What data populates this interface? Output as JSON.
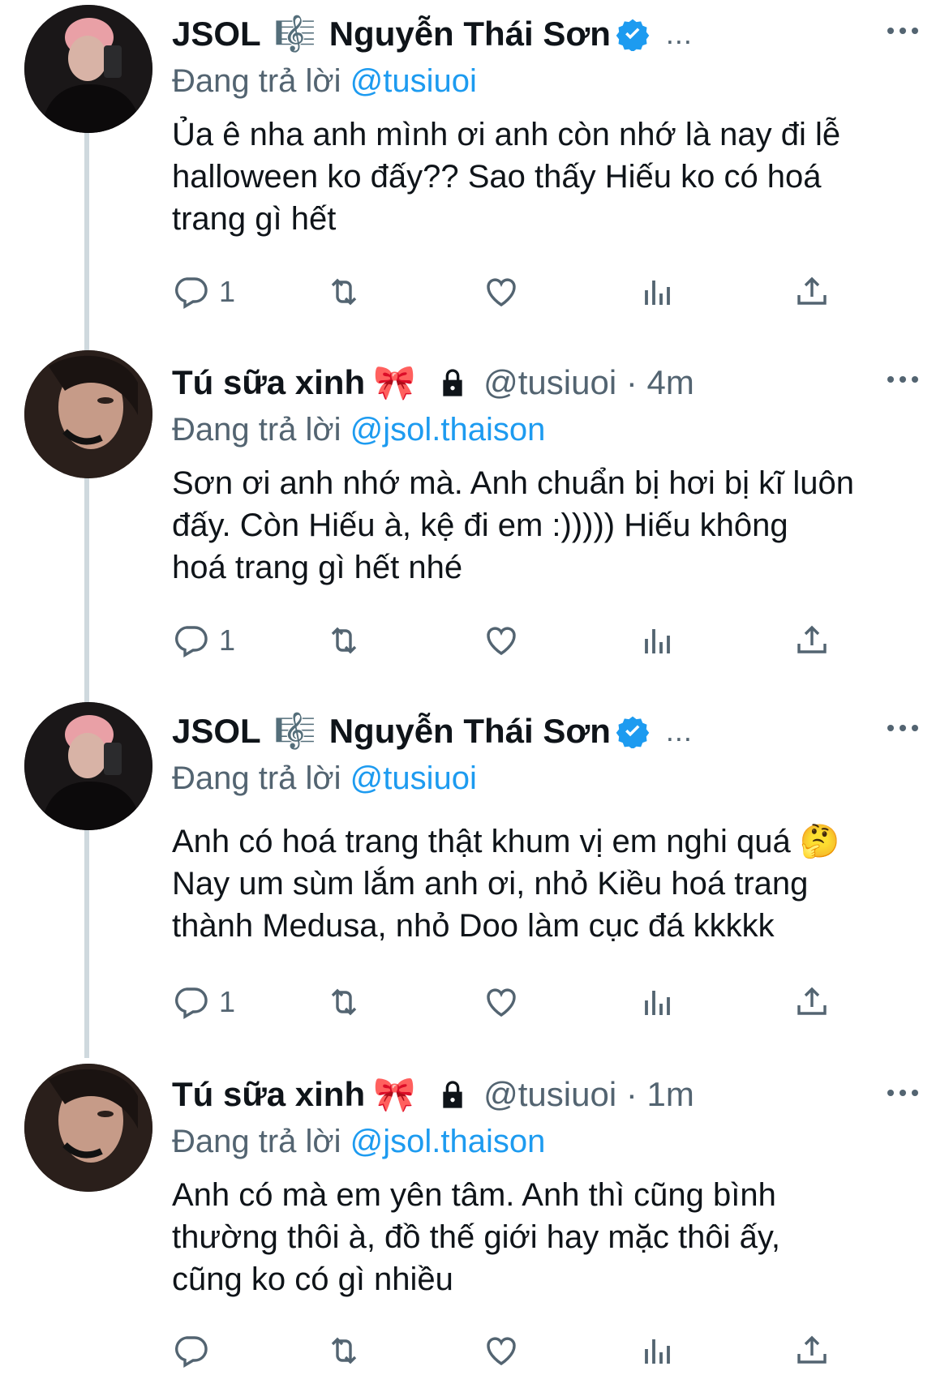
{
  "colors": {
    "accent": "#1d9bf0",
    "secondary_text": "#536471",
    "primary_text": "#0f1419",
    "thread_line": "#cfd9de"
  },
  "tweets": [
    {
      "author_display": "JSOL",
      "author_emoji": "🎼",
      "author_name": "Nguyễn Thái Sơn",
      "verified": true,
      "trailing_ellipsis": "...",
      "handle": "",
      "replying_prefix": "Đang trả lời",
      "replying_to": "@tusiuoi",
      "text": "Ủa ê nha anh mình ơi anh còn nhớ là nay đi lễ\nhalloween ko đấy?? Sao thấy Hiếu ko có hoá\ntrang gì hết",
      "reply_count": "1",
      "avatar_icon": "person-avatar-pink-hair"
    },
    {
      "author_display": "Tú sữa xinh",
      "author_emoji": "🎀",
      "lock_icon": "lock-icon",
      "handle": "@tusiuoi · 4m",
      "replying_prefix": "Đang trả lời",
      "replying_to": "@jsol.thaison",
      "text": "Sơn ơi anh nhớ mà. Anh chuẩn bị hơi bị kĩ luôn\nđấy. Còn Hiếu à, kệ đi em :))))) Hiếu không\nhoá trang gì hết nhé",
      "reply_count": "1",
      "avatar_icon": "person-avatar-face"
    },
    {
      "author_display": "JSOL",
      "author_emoji": "🎼",
      "author_name": "Nguyễn Thái Sơn",
      "verified": true,
      "trailing_ellipsis": "...",
      "replying_prefix": "Đang trả lời",
      "replying_to": "@tusiuoi",
      "text": "Anh có hoá trang thật khum vị em nghi quá 🤔\nNay um sùm lắm anh ơi, nhỏ Kiều hoá trang\nthành Medusa, nhỏ Doo làm cục đá kkkkk",
      "reply_count": "1",
      "avatar_icon": "person-avatar-pink-hair"
    },
    {
      "author_display": "Tú sữa xinh",
      "author_emoji": "🎀",
      "lock_icon": "lock-icon",
      "handle": "@tusiuoi · 1m",
      "replying_prefix": "Đang trả lời",
      "replying_to": "@jsol.thaison",
      "text": "Anh có mà em yên tâm. Anh thì cũng bình\nthường thôi à, đồ thế giới hay mặc thôi ấy,\ncũng ko có gì nhiều",
      "reply_count": "",
      "avatar_icon": "person-avatar-face"
    }
  ]
}
